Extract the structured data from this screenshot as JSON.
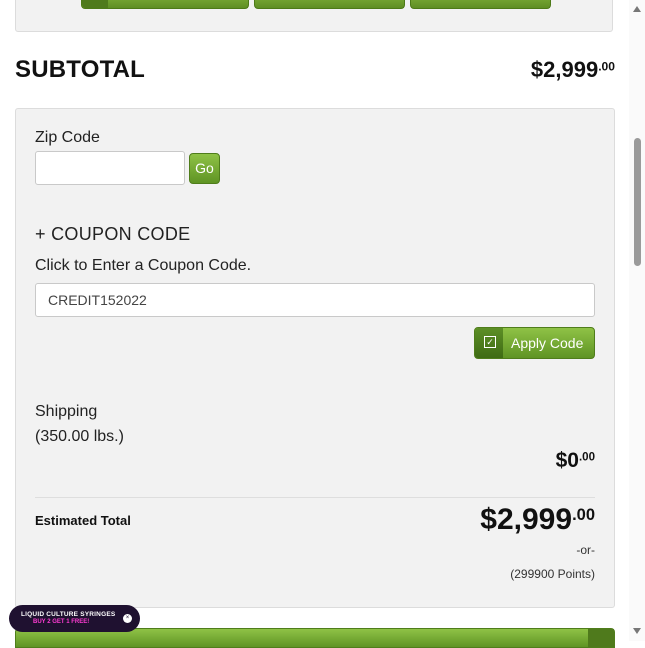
{
  "cart": {
    "subtotal_label": "SUBTOTAL",
    "subtotal_dollars": "$2,999",
    "subtotal_cents": ".00"
  },
  "zip": {
    "label": "Zip Code",
    "value": "",
    "go_label": "Go"
  },
  "coupon": {
    "toggle_label": "+ COUPON CODE",
    "hint": "Click to Enter a Coupon Code.",
    "value": "CREDIT152022",
    "apply_label": "Apply Code",
    "apply_icon": "checkbox-icon"
  },
  "shipping": {
    "label": "Shipping",
    "weight": "(350.00 lbs.)",
    "price_dollars": "$0",
    "price_cents": ".00"
  },
  "estimate": {
    "label": "Estimated Total",
    "total_dollars": "$2,999",
    "total_cents": ".00",
    "or_text": "-or-",
    "points": "(299900 Points)"
  },
  "promo": {
    "line1": "LIQUID CULTURE SYRINGES",
    "line2": "BUY 2 GET 1 FREE!",
    "close_icon": "close-icon"
  },
  "colors": {
    "accent_green": "#6fa22e",
    "promo_pink": "#ff3bd3",
    "promo_bg": "#1f1130"
  }
}
